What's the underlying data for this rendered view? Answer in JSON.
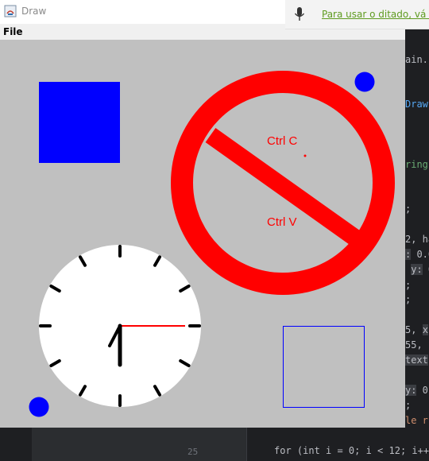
{
  "window": {
    "title": "Draw"
  },
  "menu": {
    "file": "File"
  },
  "dictation": {
    "text": "Para usar o ditado, vá pa"
  },
  "canvas": {
    "no_symbol": {
      "copy_label": "Ctrl C",
      "paste_label": "Ctrl V"
    },
    "clock": {
      "tick_count": 12,
      "hour_hand": "6",
      "minute_hand": "15"
    },
    "colors": {
      "blue": "#0000ff",
      "red": "#ff0000",
      "background": "#c0c0c0",
      "clock_face": "#ffffff"
    }
  },
  "ide": {
    "line_number": "25",
    "bottom_code": "for (int i = 0; i < 12; i++"
  }
}
